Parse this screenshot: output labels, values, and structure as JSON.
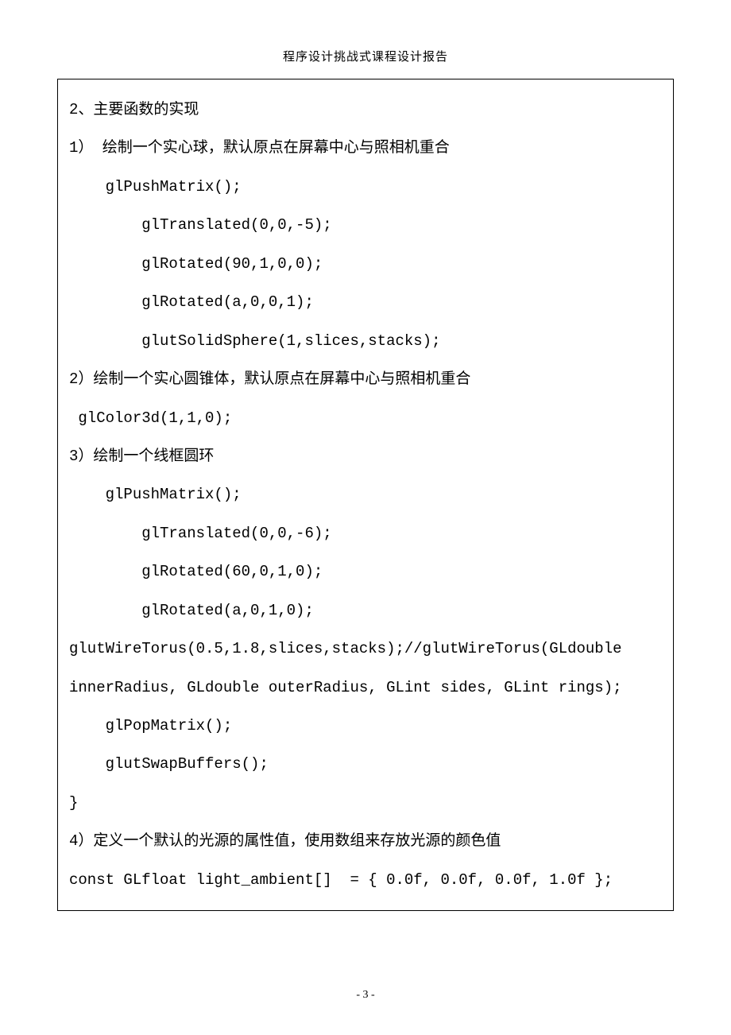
{
  "header": "程序设计挑战式课程设计报告",
  "lines": [
    "2、主要函数的实现",
    "1） 绘制一个实心球，默认原点在屏幕中心与照相机重合",
    "    glPushMatrix();",
    "        glTranslated(0,0,-5);",
    "        glRotated(90,1,0,0);",
    "        glRotated(a,0,0,1);",
    "        glutSolidSphere(1,slices,stacks);",
    "2）绘制一个实心圆锥体，默认原点在屏幕中心与照相机重合",
    " glColor3d(1,1,0);",
    "3）绘制一个线框圆环",
    "    glPushMatrix();",
    "        glTranslated(0,0,-6);",
    "        glRotated(60,0,1,0);",
    "        glRotated(a,0,1,0);",
    "glutWireTorus(0.5,1.8,slices,stacks);//glutWireTorus(GLdouble",
    "innerRadius, GLdouble outerRadius, GLint sides, GLint rings);",
    "    glPopMatrix();",
    "",
    "    glutSwapBuffers();",
    "}",
    "4）定义一个默认的光源的属性值，使用数组来存放光源的颜色值",
    "const GLfloat light_ambient[]  = { 0.0f, 0.0f, 0.0f, 1.0f };"
  ],
  "footer": "- 3 -"
}
